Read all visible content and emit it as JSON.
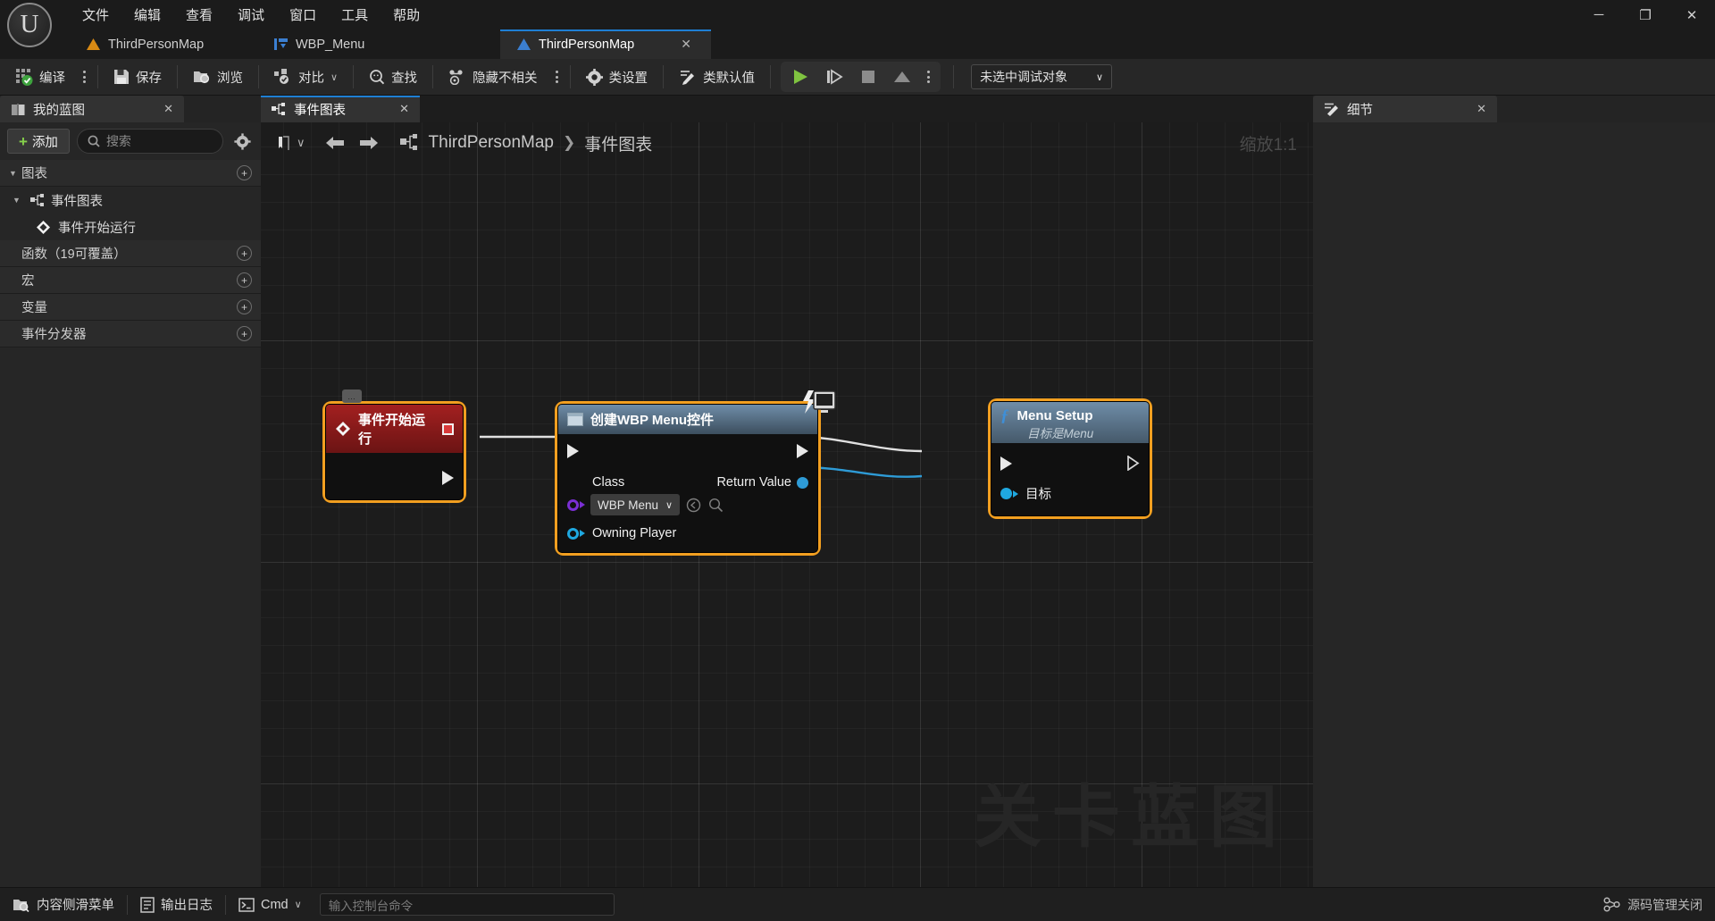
{
  "window": {
    "minimize_label": "─",
    "maximize_label": "❐",
    "close_label": "✕"
  },
  "menubar": {
    "items": [
      {
        "label": "文件"
      },
      {
        "label": "编辑"
      },
      {
        "label": "查看"
      },
      {
        "label": "调试"
      },
      {
        "label": "窗口"
      },
      {
        "label": "工具"
      },
      {
        "label": "帮助"
      }
    ]
  },
  "asset_tabs": [
    {
      "label": "ThirdPersonMap",
      "icon": "level-icon",
      "active": false
    },
    {
      "label": "WBP_Menu",
      "icon": "widget-blueprint-icon",
      "active": false
    },
    {
      "label": "ThirdPersonMap",
      "icon": "level-blueprint-icon",
      "active": true,
      "close": "✕"
    }
  ],
  "toolbar": {
    "compile_label": "编译",
    "save_label": "保存",
    "browse_label": "浏览",
    "diff_label": "对比",
    "find_label": "查找",
    "hide_unrelated_label": "隐藏不相关",
    "class_settings_label": "类设置",
    "class_defaults_label": "类默认值",
    "play_label": "play-icon",
    "step_label": "step-icon",
    "stop_label": "stop-icon",
    "eject_label": "eject-icon",
    "debug_object": "未选中调试对象",
    "chevron": "∨"
  },
  "my_blueprint": {
    "tab_title": "我的蓝图",
    "tab_close": "✕",
    "add_label": "添加",
    "add_plus": "+",
    "search_placeholder": "搜索",
    "sections": [
      {
        "label": "图表",
        "caret": "▼",
        "add": "+",
        "level": 0
      },
      {
        "label": "事件图表",
        "caret": "▼",
        "add": "",
        "level": 1,
        "icon": "graph-icon"
      },
      {
        "label": "事件开始运行",
        "caret": "",
        "add": "",
        "level": 2,
        "icon": "event-node-icon"
      },
      {
        "label": "函数（19可覆盖）",
        "caret": "",
        "add": "+",
        "level": 0
      },
      {
        "label": "宏",
        "caret": "",
        "add": "+",
        "level": 0
      },
      {
        "label": "变量",
        "caret": "",
        "add": "+",
        "level": 0
      },
      {
        "label": "事件分发器",
        "caret": "",
        "add": "+",
        "level": 0
      }
    ]
  },
  "graph": {
    "tab_title": "事件图表",
    "tab_close": "✕",
    "bookmark_icon": "bookmark-icon",
    "bookmark_chevron": "∨",
    "back_arrow": "←",
    "forward_arrow": "→",
    "breadcrumb": [
      {
        "label": "ThirdPersonMap",
        "icon": "graph-icon"
      },
      {
        "label": "事件图表"
      }
    ],
    "breadcrumb_separator": "❯",
    "zoom_label": "缩放1:1",
    "watermark": "关卡蓝图"
  },
  "nodes": [
    {
      "id": "event-begin-play",
      "title": "事件开始运行",
      "type": "event",
      "selected": true,
      "breakpoint_badge": true,
      "comment_bubble": "…",
      "out_exec": ""
    },
    {
      "id": "create-widget",
      "title": "创建WBP Menu控件",
      "type": "widget",
      "selected": true,
      "class_pin_label": "Class",
      "class_value": "WBP Menu",
      "class_chevron": "∨",
      "owning_player_label": "Owning Player",
      "return_value_label": "Return Value"
    },
    {
      "id": "menu-setup",
      "title": "Menu Setup",
      "subtitle": "目标是Menu",
      "type": "function",
      "selected": true,
      "target_label": "目标",
      "f_glyph": "ƒ"
    }
  ],
  "details": {
    "tab_title": "细节",
    "tab_close": "✕"
  },
  "statusbar": {
    "content_drawer_label": "内容侧滑菜单",
    "output_log_label": "输出日志",
    "cmd_label": "Cmd",
    "cmd_chevron": "∨",
    "cmd_placeholder": "输入控制台命令",
    "source_control_label": "源码管理关闭"
  },
  "colors": {
    "accent_blue": "#1f7fd4",
    "selected_orange": "#f29f20",
    "exec_white": "#e8e8e8",
    "object_blue": "#36a9e1",
    "class_purple": "#7b2fd4",
    "event_red": "#a32020",
    "compile_green": "#86d14b"
  }
}
